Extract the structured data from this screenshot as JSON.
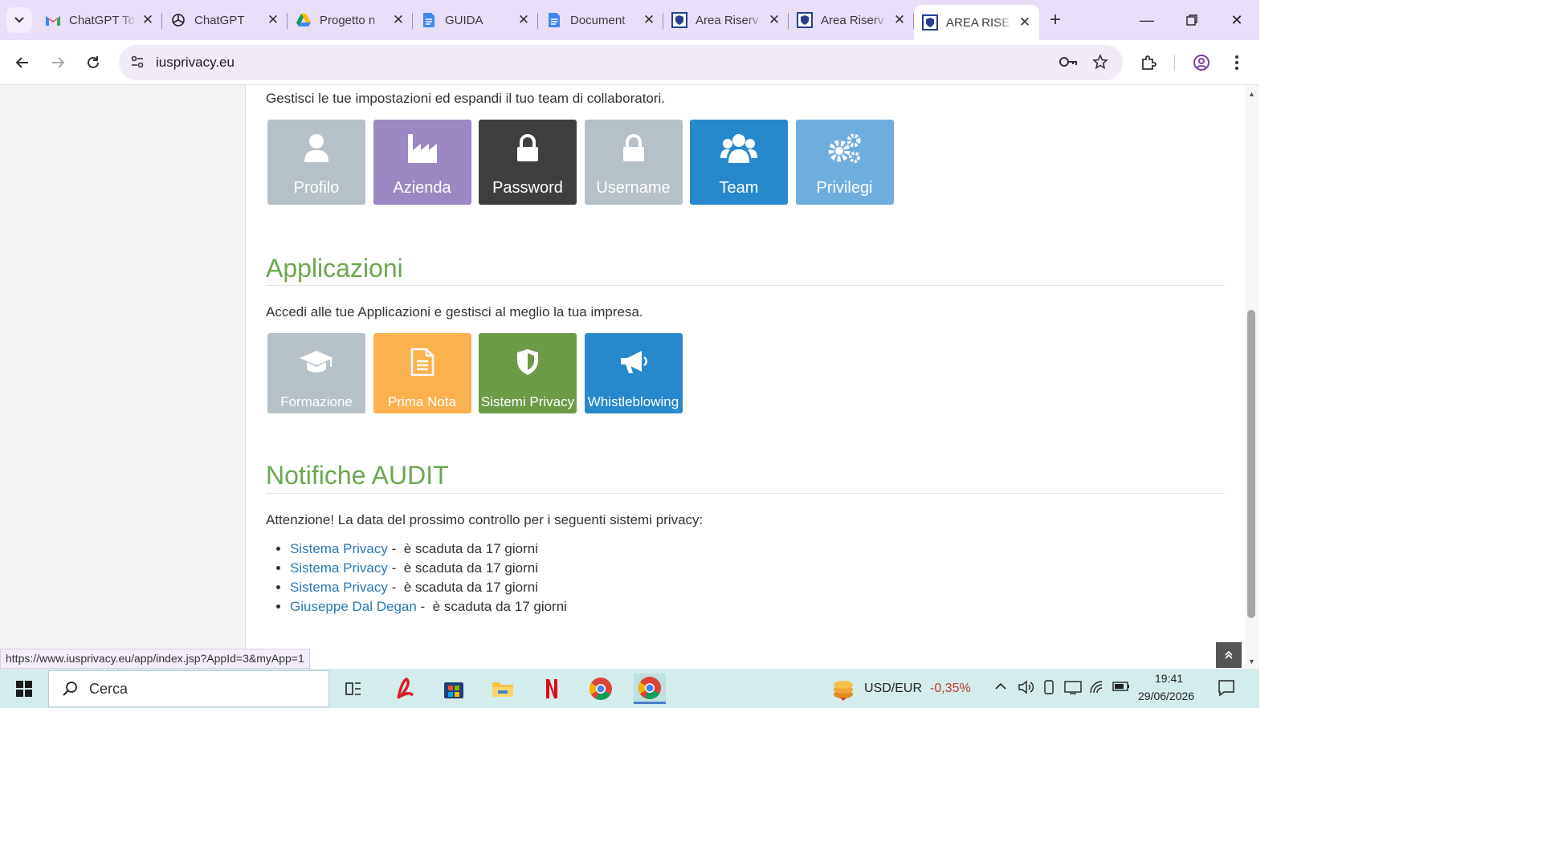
{
  "browser": {
    "tabs": [
      {
        "title": "ChatGPT To",
        "icon": "gmail-icon"
      },
      {
        "title": "ChatGPT",
        "icon": "chatgpt-icon"
      },
      {
        "title": "Progetto n",
        "icon": "drive-icon"
      },
      {
        "title": "GUIDA",
        "icon": "docs-icon"
      },
      {
        "title": "Document",
        "icon": "docs-icon"
      },
      {
        "title": "Area Riserv",
        "icon": "shield-icon"
      },
      {
        "title": "Area Riserv",
        "icon": "shield-icon"
      },
      {
        "title": "AREA RISE",
        "icon": "shield-icon",
        "active": true
      }
    ],
    "url": "iusprivacy.eu",
    "status_url": "https://www.iusprivacy.eu/app/index.jsp?AppId=3&myApp=1"
  },
  "settings": {
    "intro": "Gestisci le tue impostazioni ed espandi il tuo team di collaboratori.",
    "tiles": [
      {
        "label": "Profilo",
        "icon": "user-icon",
        "color": "#b5c0c7"
      },
      {
        "label": "Azienda",
        "icon": "factory-icon",
        "color": "#9b88c4"
      },
      {
        "label": "Password",
        "icon": "lock-icon",
        "color": "#3f3f3f"
      },
      {
        "label": "Username",
        "icon": "lock-icon",
        "color": "#b5c0c7"
      },
      {
        "label": "Team",
        "icon": "users-icon",
        "color": "#2789cc"
      },
      {
        "label": "Privilegi",
        "icon": "gears-icon",
        "color": "#6eaedf"
      }
    ]
  },
  "applications": {
    "title": "Applicazioni",
    "intro": "Accedi alle tue Applicazioni e gestisci al meglio la tua impresa.",
    "tiles": [
      {
        "label": "Formazione",
        "icon": "graduation-cap-icon",
        "color": "#b5c0c7"
      },
      {
        "label": "Prima Nota",
        "icon": "document-icon",
        "color": "#fbb14f"
      },
      {
        "label": "Sistemi Privacy",
        "icon": "shield-icon",
        "color": "#6d9a45"
      },
      {
        "label": "Whistleblowing",
        "icon": "megaphone-icon",
        "color": "#2789cc"
      }
    ]
  },
  "audit": {
    "title": "Notifiche AUDIT",
    "intro": "Attenzione! La data del prossimo controllo per i seguenti sistemi privacy:",
    "items": [
      {
        "link": "Sistema Privacy",
        "text": " -  è scaduta da 17 giorni"
      },
      {
        "link": "Sistema Privacy",
        "text": " -  è scaduta da 17 giorni"
      },
      {
        "link": "Sistema Privacy",
        "text": " -  è scaduta da 17 giorni"
      },
      {
        "link": "Giuseppe Dal Degan",
        "text": " -  è scaduta da 17 giorni"
      }
    ]
  },
  "taskbar": {
    "search_placeholder": "Cerca",
    "ticker_label": "USD/EUR",
    "ticker_value": "-0,35%",
    "time": "19:41",
    "date": "29/06/2026"
  }
}
